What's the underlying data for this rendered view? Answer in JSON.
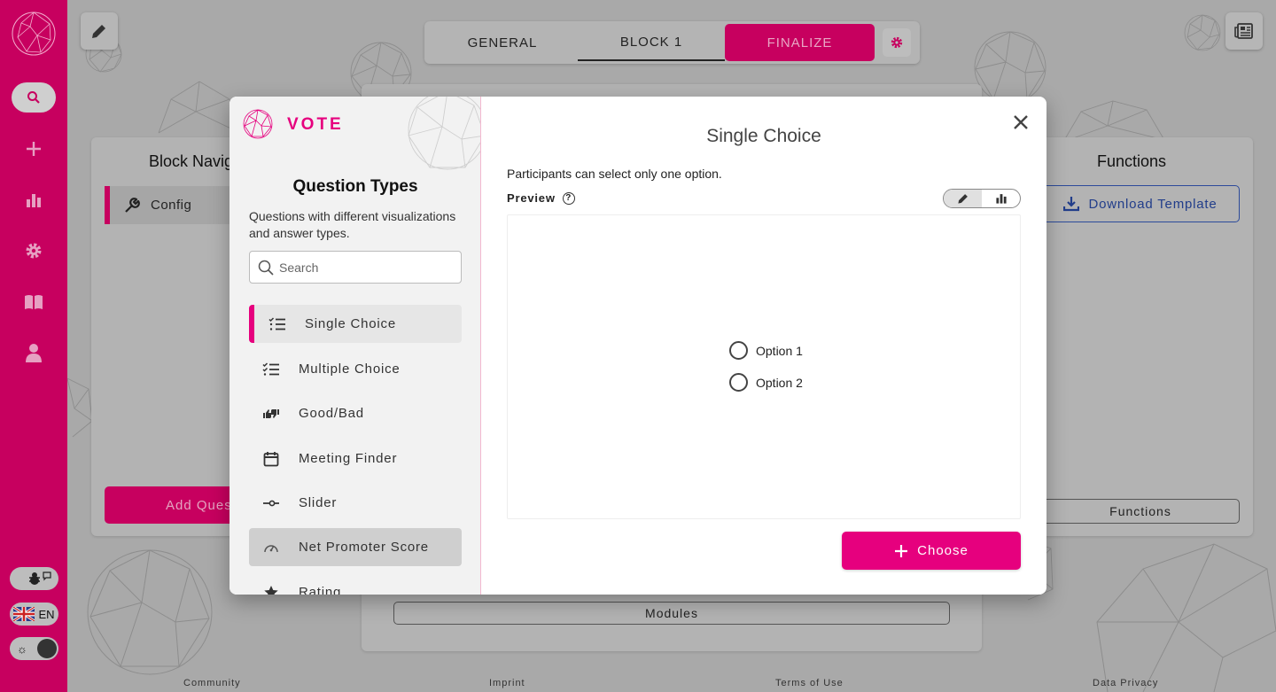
{
  "sidebar": {
    "language": "EN",
    "items": [
      {
        "icon": "search-icon"
      },
      {
        "icon": "plus-icon"
      },
      {
        "icon": "bar-chart-icon"
      },
      {
        "icon": "gear-icon"
      },
      {
        "icon": "book-icon"
      },
      {
        "icon": "user-icon"
      }
    ]
  },
  "header": {
    "tabs": [
      {
        "label": "GENERAL"
      },
      {
        "label": "BLOCK 1"
      },
      {
        "label": "FINALIZE"
      }
    ]
  },
  "background": {
    "block_nav_title": "Block Navig",
    "config_label": "Config",
    "add_question_label": "Add Ques",
    "functions_title": "Functions",
    "download_template_label": "Download Template",
    "functions_button_label": "Functions",
    "modules_label": "Modules"
  },
  "footer": {
    "links": [
      "Community",
      "Imprint",
      "Terms of Use",
      "Data Privacy"
    ]
  },
  "modal": {
    "module_name": "VOTE",
    "question_types_title": "Question Types",
    "question_types_desc": "Questions with different visualizations and answer types.",
    "search_placeholder": "Search",
    "question_types": [
      {
        "label": "Single Choice",
        "icon": "list-icon",
        "state": "active"
      },
      {
        "label": "Multiple Choice",
        "icon": "checklist-icon",
        "state": ""
      },
      {
        "label": "Good/Bad",
        "icon": "thumbs-icon",
        "state": ""
      },
      {
        "label": "Meeting Finder",
        "icon": "calendar-icon",
        "state": ""
      },
      {
        "label": "Slider",
        "icon": "slider-icon",
        "state": ""
      },
      {
        "label": "Net Promoter Score",
        "icon": "gauge-icon",
        "state": "hover"
      },
      {
        "label": "Rating",
        "icon": "star-icon",
        "state": ""
      }
    ],
    "selected_title": "Single Choice",
    "selected_desc": "Participants can select only one option.",
    "preview_label": "Preview",
    "preview_options": [
      "Option 1",
      "Option 2"
    ],
    "choose_label": "Choose"
  },
  "colors": {
    "brand": "#e6007e",
    "brand_dimmed": "#c7005f",
    "link_blue": "#213d8a"
  }
}
